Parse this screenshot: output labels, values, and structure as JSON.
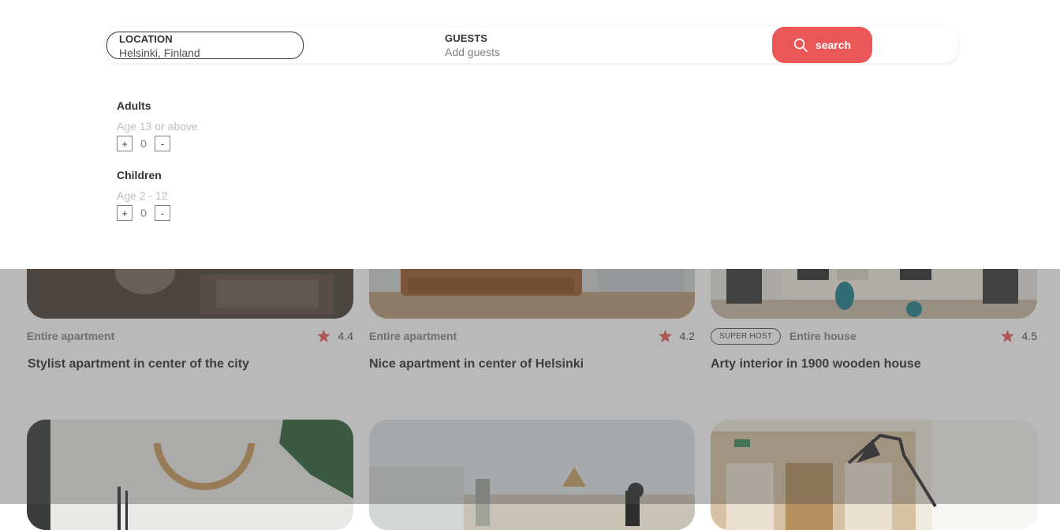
{
  "search": {
    "location_label": "LOCATION",
    "location_value": "Helsinki, Finland",
    "guests_label": "GUESTS",
    "guests_placeholder": "Add guests",
    "button_label": "search",
    "button_icon": "search-icon"
  },
  "guests": [
    {
      "title": "Adults",
      "subtitle": "Age 13 or above",
      "count": "0",
      "plus": "+",
      "minus": "-"
    },
    {
      "title": "Children",
      "subtitle": "Age 2 - 12",
      "count": "0",
      "plus": "+",
      "minus": "-"
    }
  ],
  "listings": [
    {
      "type": "Entire apartment",
      "rating": "4.4",
      "title": "Stylist apartment in center of the city",
      "superhost": ""
    },
    {
      "type": "Entire apartment",
      "rating": "4.2",
      "title": "Nice apartment in center of Helsinki",
      "superhost": ""
    },
    {
      "type": "Entire house",
      "rating": "4.5",
      "title": "Arty interior in 1900 wooden house",
      "superhost": "SUPER HOST"
    }
  ],
  "colors": {
    "accent": "#eb5757",
    "text_dark": "#333333",
    "text_muted": "#828282",
    "overlay": "#4f4f4f"
  }
}
